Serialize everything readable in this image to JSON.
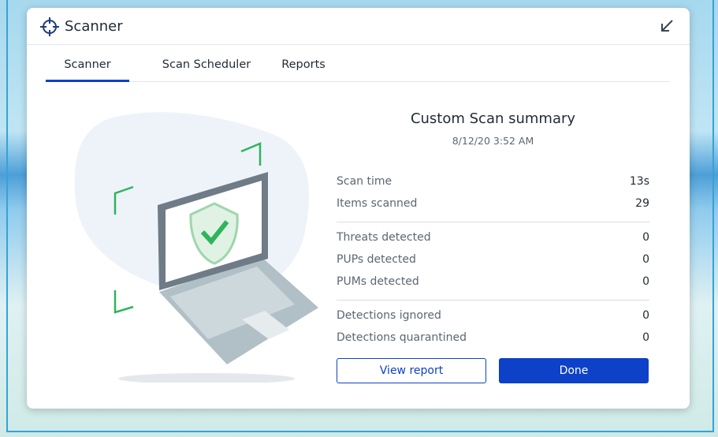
{
  "app": {
    "title": "Scanner"
  },
  "tabs": [
    {
      "label": "Scanner",
      "active": true
    },
    {
      "label": "Scan Scheduler",
      "active": false
    },
    {
      "label": "Reports",
      "active": false
    }
  ],
  "summary": {
    "title": "Custom Scan summary",
    "date": "8/12/20 3:52 AM",
    "rows": [
      {
        "label": "Scan time",
        "value": "13s"
      },
      {
        "label": "Items scanned",
        "value": "29"
      },
      {
        "label": "Threats detected",
        "value": "0"
      },
      {
        "label": "PUPs detected",
        "value": "0"
      },
      {
        "label": "PUMs detected",
        "value": "0"
      },
      {
        "label": "Detections ignored",
        "value": "0"
      },
      {
        "label": "Detections quarantined",
        "value": "0"
      }
    ]
  },
  "buttons": {
    "view_report": "View report",
    "done": "Done"
  },
  "colors": {
    "accent": "#0d41c7",
    "shield_green": "#2fb45a",
    "laptop_frame": "#6f7b87",
    "laptop_base": "#b1c0c6"
  },
  "icons": {
    "app": "crosshair-icon",
    "collapse": "arrow-down-left-icon",
    "illustration": "laptop-shield-check-icon"
  }
}
